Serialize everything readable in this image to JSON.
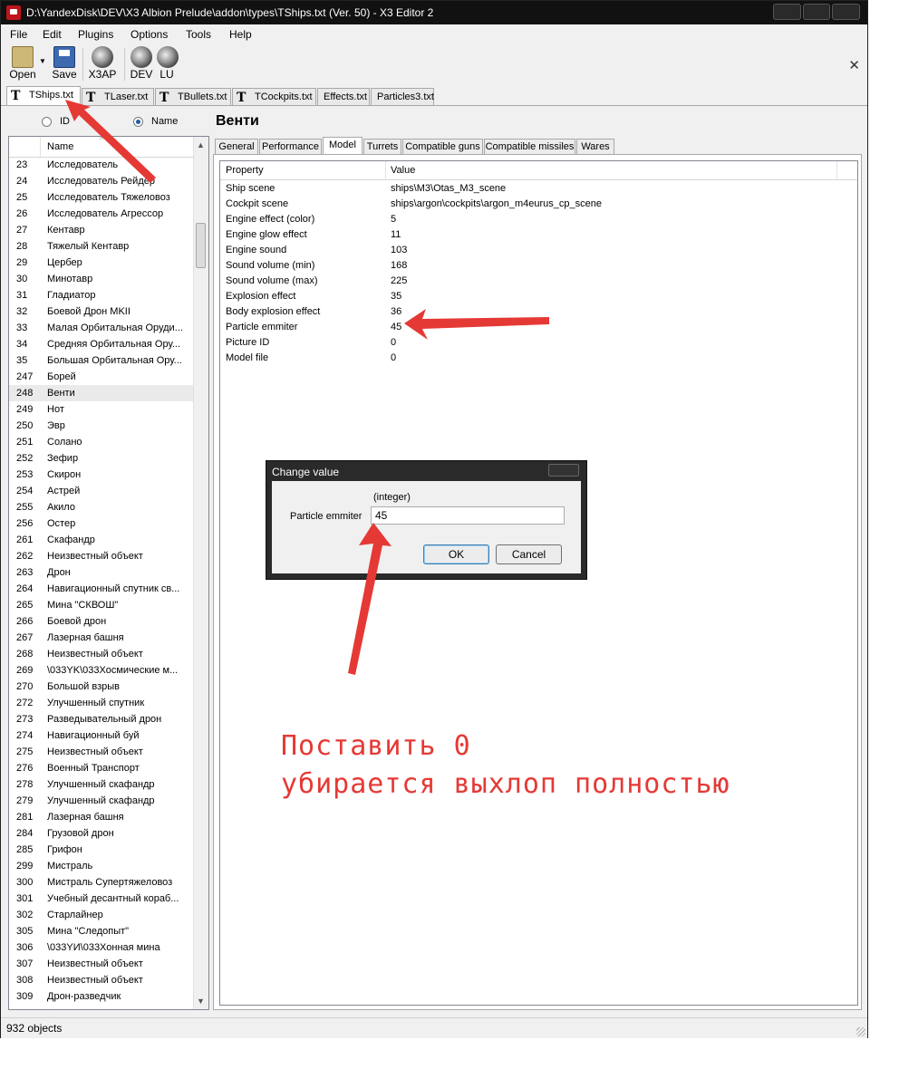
{
  "window": {
    "title": "D:\\YandexDisk\\DEV\\X3 Albion Prelude\\addon\\types\\TShips.txt (Ver. 50) - X3 Editor 2"
  },
  "menu": [
    "File",
    "Edit",
    "Plugins",
    "Options",
    "Tools",
    "Help"
  ],
  "toolbar": {
    "open": "Open",
    "save": "Save",
    "x3ap": "X3AP",
    "dev": "DEV",
    "lu": "LU"
  },
  "file_tabs": [
    "TShips.txt",
    "TLaser.txt",
    "TBullets.txt",
    "TCockpits.txt",
    "Effects.txt",
    "Particles3.txt"
  ],
  "file_tab_active": "TShips.txt",
  "left_panel": {
    "radio_id": "ID",
    "radio_name": "Name",
    "selected_radio": "Name",
    "column_name": "Name",
    "rows": [
      [
        "23",
        "Исследователь"
      ],
      [
        "24",
        "Исследователь Рейдер"
      ],
      [
        "25",
        "Исследователь Тяжеловоз"
      ],
      [
        "26",
        "Исследователь Агрессор"
      ],
      [
        "27",
        "Кентавр"
      ],
      [
        "28",
        "Тяжелый Кентавр"
      ],
      [
        "29",
        "Цербер"
      ],
      [
        "30",
        "Минотавр"
      ],
      [
        "31",
        "Гладиатор"
      ],
      [
        "32",
        "Боевой Дрон MKII"
      ],
      [
        "33",
        "Малая Орбитальная Оруди..."
      ],
      [
        "34",
        "Средняя Орбитальная Ору..."
      ],
      [
        "35",
        "Большая Орбитальная Ору..."
      ],
      [
        "247",
        "Борей"
      ],
      [
        "248",
        "Венти"
      ],
      [
        "249",
        "Нот"
      ],
      [
        "250",
        "Эвр"
      ],
      [
        "251",
        "Солано"
      ],
      [
        "252",
        "Зефир"
      ],
      [
        "253",
        "Скирон"
      ],
      [
        "254",
        "Астрей"
      ],
      [
        "255",
        "Акило"
      ],
      [
        "256",
        "Остер"
      ],
      [
        "261",
        "Скафандр"
      ],
      [
        "262",
        "Неизвестный объект"
      ],
      [
        "263",
        "Дрон"
      ],
      [
        "264",
        "Навигационный спутник св..."
      ],
      [
        "265",
        "Мина \"СКВОШ\""
      ],
      [
        "266",
        "Боевой дрон"
      ],
      [
        "267",
        "Лазерная башня"
      ],
      [
        "268",
        "Неизвестный объект"
      ],
      [
        "269",
        "\\033YK\\033Хосмические м..."
      ],
      [
        "270",
        "Большой взрыв"
      ],
      [
        "272",
        "Улучшенный спутник"
      ],
      [
        "273",
        "Разведывательный дрон"
      ],
      [
        "274",
        "Навигационный буй"
      ],
      [
        "275",
        "Неизвестный объект"
      ],
      [
        "276",
        "Военный Транспорт"
      ],
      [
        "278",
        "Улучшенный скафандр"
      ],
      [
        "279",
        "Улучшенный скафандр"
      ],
      [
        "281",
        "Лазерная башня"
      ],
      [
        "284",
        "Грузовой дрон"
      ],
      [
        "285",
        "Грифон"
      ],
      [
        "299",
        "Мистраль"
      ],
      [
        "300",
        "Мистраль Супертяжеловоз"
      ],
      [
        "301",
        "Учебный десантный кораб..."
      ],
      [
        "302",
        "Старлайнер"
      ],
      [
        "305",
        "Мина \"Следопыт\""
      ],
      [
        "306",
        "\\033YИ\\033Хонная мина"
      ],
      [
        "307",
        "Неизвестный объект"
      ],
      [
        "308",
        "Неизвестный объект"
      ],
      [
        "309",
        "Дрон-разведчик"
      ]
    ],
    "selected_id": "248"
  },
  "right_panel": {
    "object_title": "Венти",
    "tabs": [
      "General",
      "Performance",
      "Model",
      "Turrets",
      "Compatible guns",
      "Compatible missiles",
      "Wares"
    ],
    "active_tab": "Model",
    "col_property": "Property",
    "col_value": "Value",
    "properties": [
      [
        "Ship scene",
        "ships\\M3\\Otas_M3_scene"
      ],
      [
        "Cockpit scene",
        "ships\\argon\\cockpits\\argon_m4eurus_cp_scene"
      ],
      [
        "Engine effect (color)",
        "5"
      ],
      [
        "Engine glow effect",
        "11"
      ],
      [
        "Engine sound",
        "103"
      ],
      [
        "Sound volume (min)",
        "168"
      ],
      [
        "Sound volume (max)",
        "225"
      ],
      [
        "Explosion effect",
        "35"
      ],
      [
        "Body explosion effect",
        "36"
      ],
      [
        "Particle emmiter",
        "45"
      ],
      [
        "Picture ID",
        "0"
      ],
      [
        "Model file",
        "0"
      ]
    ]
  },
  "status": "932 objects",
  "dialog": {
    "title": "Change value",
    "hint": "(integer)",
    "label": "Particle emmiter",
    "value": "45",
    "ok": "OK",
    "cancel": "Cancel"
  },
  "annotation": {
    "line1": "Поставить 0",
    "line2": "убирается выхлоп полностью",
    "color": "#e53935"
  }
}
